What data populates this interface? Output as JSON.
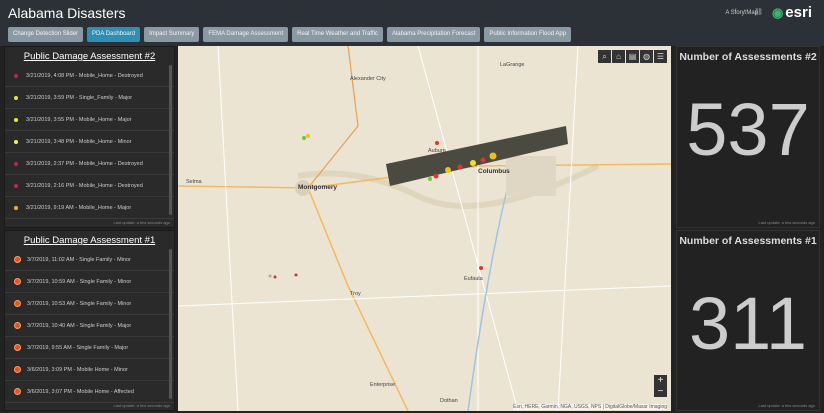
{
  "header": {
    "title": "Alabama Disasters",
    "story_map": "A Story Map",
    "social": "f t ⛓",
    "logo": "esri"
  },
  "tabs": [
    {
      "label": "Change Detection Slider"
    },
    {
      "label": "PDA Dashboard",
      "active": true
    },
    {
      "label": "Impact Summary"
    },
    {
      "label": "FEMA Damage Assessment"
    },
    {
      "label": "Real Time Weather and Traffic"
    },
    {
      "label": "Alabama Precipitation Forecast"
    },
    {
      "label": "Public Information Flood App"
    }
  ],
  "pda2": {
    "title": "Public Damage Assessment #2",
    "updated": "Last update: a few seconds ago",
    "items": [
      {
        "text": "3/21/2019, 4:08 PM - Mobile_Home - Destroyed",
        "color": "#c0294a"
      },
      {
        "text": "3/21/2019, 3:59 PM - Single_Family - Major",
        "color": "#e8e83a"
      },
      {
        "text": "3/21/2019, 3:55 PM - Mobile_Home - Major",
        "color": "#e8e83a"
      },
      {
        "text": "3/21/2019, 3:48 PM - Mobile_Home - Minor",
        "color": "#f0f060"
      },
      {
        "text": "3/21/2019, 2:37 PM - Mobile_Home - Destroyed",
        "color": "#c0294a"
      },
      {
        "text": "3/21/2019, 2:16 PM - Mobile_Home - Destroyed",
        "color": "#c0294a"
      },
      {
        "text": "3/21/2019, 9:19 AM - Mobile_Home - Major",
        "color": "#e8b83a"
      }
    ]
  },
  "pda1": {
    "title": "Public Damage Assessment #1",
    "updated": "Last update: a few seconds ago",
    "items": [
      {
        "text": "3/7/2019, 11:02 AM - Single Family - Minor"
      },
      {
        "text": "3/7/2019, 10:59 AM - Single Family - Minor"
      },
      {
        "text": "3/7/2019, 10:53 AM - Single Family - Minor"
      },
      {
        "text": "3/7/2019, 10:40 AM - Single Family - Major"
      },
      {
        "text": "3/7/2019, 9:55 AM - Single Family - Major"
      },
      {
        "text": "3/6/2019, 3:09 PM - Mobile Home - Minor"
      },
      {
        "text": "3/6/2019, 3:07 PM - Mobile Home - Affected"
      }
    ]
  },
  "map": {
    "labels": [
      "Alexander City",
      "LaGrange",
      "Auburn",
      "Columbus",
      "Selma",
      "Montgomery",
      "Eufaula",
      "Troy",
      "Enterprise",
      "Dothan"
    ],
    "attribution": "Esri, HERE, Garmin, NGA, USGS, NPS | DigitalGlobe/Maxar Imaging",
    "zoom_in": "+",
    "zoom_out": "−"
  },
  "ind2": {
    "title": "Number of Assessments #2",
    "value": "537",
    "updated": "Last update: a few seconds ago"
  },
  "ind1": {
    "title": "Number of Assessments #1",
    "value": "311",
    "updated": "Last update: a few seconds ago"
  }
}
